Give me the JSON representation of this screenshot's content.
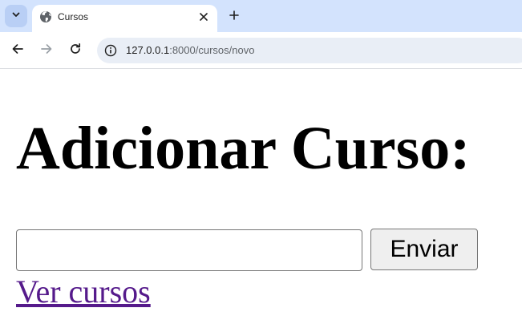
{
  "browser": {
    "tab": {
      "title": "Cursos",
      "favicon": "globe-icon"
    },
    "toolbar": {
      "url_host": "127.0.0.1",
      "url_rest": ":8000/cursos/novo",
      "site_info_icon": "info-icon"
    },
    "icons": {
      "tab_search": "chevron-down-icon",
      "close_tab": "close-icon",
      "new_tab": "plus-icon",
      "back": "arrow-left-icon",
      "forward": "arrow-right-icon",
      "reload": "reload-icon"
    },
    "colors": {
      "tabstrip": "#d3e3fd",
      "omnibox": "#e9eef6",
      "visited_link": "#551a8b"
    }
  },
  "page": {
    "heading": "Adicionar Curso:",
    "form": {
      "input_value": "",
      "submit_label": "Enviar"
    },
    "link": {
      "label": "Ver cursos"
    }
  }
}
